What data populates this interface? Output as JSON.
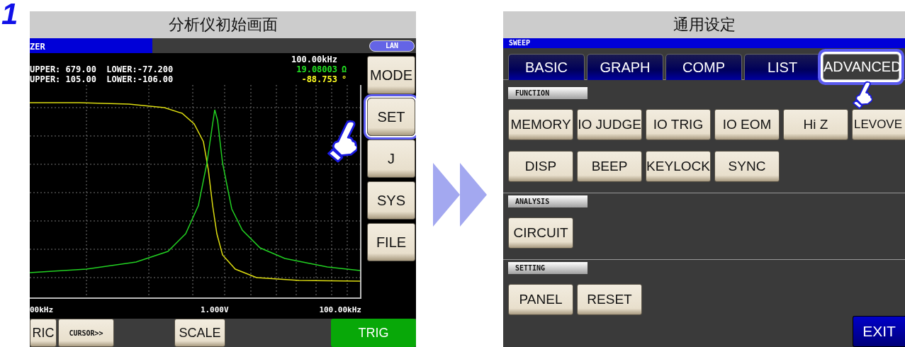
{
  "step": "1",
  "left_screen": {
    "title": "分析仪初始画面",
    "mode_label": "ZER",
    "lan": "LAN",
    "frequency": "100.00kHz",
    "readouts": [
      {
        "limits": "UPPER: 679.00  LOWER:-77.200",
        "value": "19.08003",
        "unit": "Ω",
        "color": "#22e022"
      },
      {
        "limits": "UPPER: 105.00  LOWER:-106.00",
        "value": "-88.753",
        "unit": "°",
        "color": "#ffff22"
      }
    ],
    "axis_labels": [
      "00kHz",
      "1.000V",
      "100.00kHz"
    ],
    "side_buttons": [
      {
        "label": "MODE",
        "highlighted": false
      },
      {
        "label": "SET",
        "highlighted": true
      },
      {
        "label": "J",
        "highlighted": false
      },
      {
        "label": "SYS",
        "highlighted": false
      },
      {
        "label": "FILE",
        "highlighted": false
      }
    ],
    "bottom_buttons": [
      {
        "label": "RIC",
        "kind": "plain"
      },
      {
        "label": "CURSOR>>",
        "kind": "small"
      },
      {
        "label": "SCALE",
        "kind": "plain"
      },
      {
        "label": "TRIG",
        "kind": "trigger"
      }
    ]
  },
  "right_screen": {
    "title": "通用设定",
    "header": "SWEEP",
    "tabs": [
      {
        "label": "BASIC",
        "selected": false,
        "highlighted": false
      },
      {
        "label": "GRAPH",
        "selected": false,
        "highlighted": false
      },
      {
        "label": "COMP",
        "selected": false,
        "highlighted": false
      },
      {
        "label": "LIST",
        "selected": false,
        "highlighted": false
      },
      {
        "label": "ADVANCED",
        "selected": true,
        "highlighted": true
      }
    ],
    "sections": [
      {
        "label": "FUNCTION",
        "rows": [
          [
            {
              "label": "MEMORY",
              "kind": "full"
            },
            {
              "label": "IO JUDGE",
              "kind": "full"
            },
            {
              "label": "IO TRIG",
              "kind": "full"
            },
            {
              "label": "IO EOM",
              "kind": "full"
            },
            {
              "label": "Hi Z",
              "kind": "full"
            },
            {
              "label": "LEVOVE",
              "kind": "clipped"
            }
          ],
          [
            {
              "label": "DISP",
              "kind": "full"
            },
            {
              "label": "BEEP",
              "kind": "full"
            },
            {
              "label": "KEYLOCK",
              "kind": "full"
            },
            {
              "label": "SYNC",
              "kind": "full"
            }
          ]
        ]
      },
      {
        "label": "ANALYSIS",
        "rows": [
          [
            {
              "label": "CIRCUIT",
              "kind": "full"
            }
          ]
        ]
      },
      {
        "label": "SETTING",
        "rows": [
          [
            {
              "label": "PANEL",
              "kind": "full"
            },
            {
              "label": "RESET",
              "kind": "full"
            }
          ]
        ]
      }
    ],
    "exit": "EXIT"
  }
}
